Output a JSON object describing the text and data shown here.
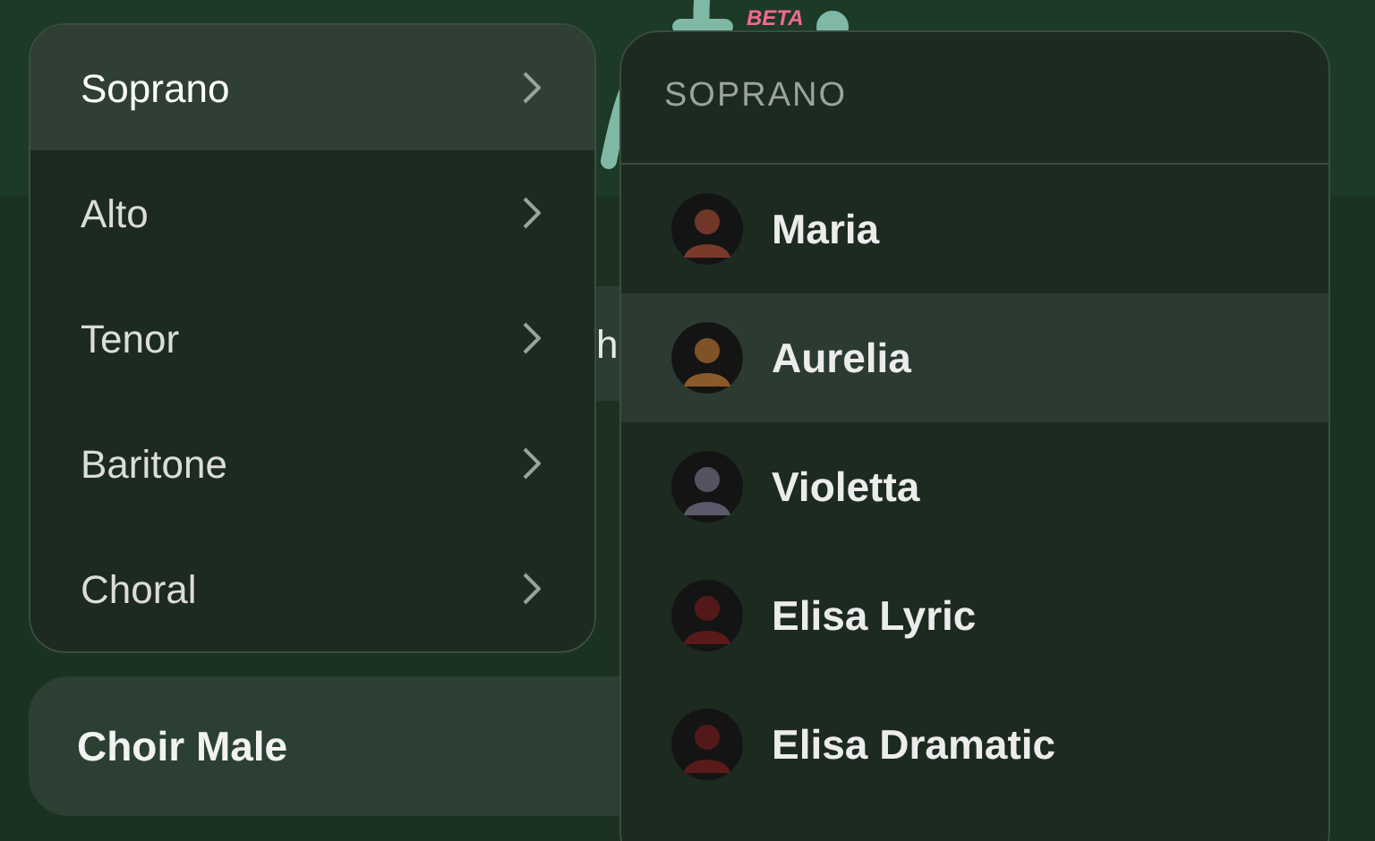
{
  "logo": {
    "badge": "BETA"
  },
  "background_field": {
    "text": "h"
  },
  "background_button": {
    "label": "Choir Male"
  },
  "voice_menu": {
    "items": [
      {
        "label": "Soprano",
        "selected": true
      },
      {
        "label": "Alto",
        "selected": false
      },
      {
        "label": "Tenor",
        "selected": false
      },
      {
        "label": "Baritone",
        "selected": false
      },
      {
        "label": "Choral",
        "selected": false
      }
    ]
  },
  "voice_submenu": {
    "heading": "SOPRANO",
    "items": [
      {
        "name": "Maria",
        "selected": false
      },
      {
        "name": "Aurelia",
        "selected": true
      },
      {
        "name": "Violetta",
        "selected": false
      },
      {
        "name": "Elisa Lyric",
        "selected": false
      },
      {
        "name": "Elisa Dramatic",
        "selected": false
      }
    ]
  }
}
